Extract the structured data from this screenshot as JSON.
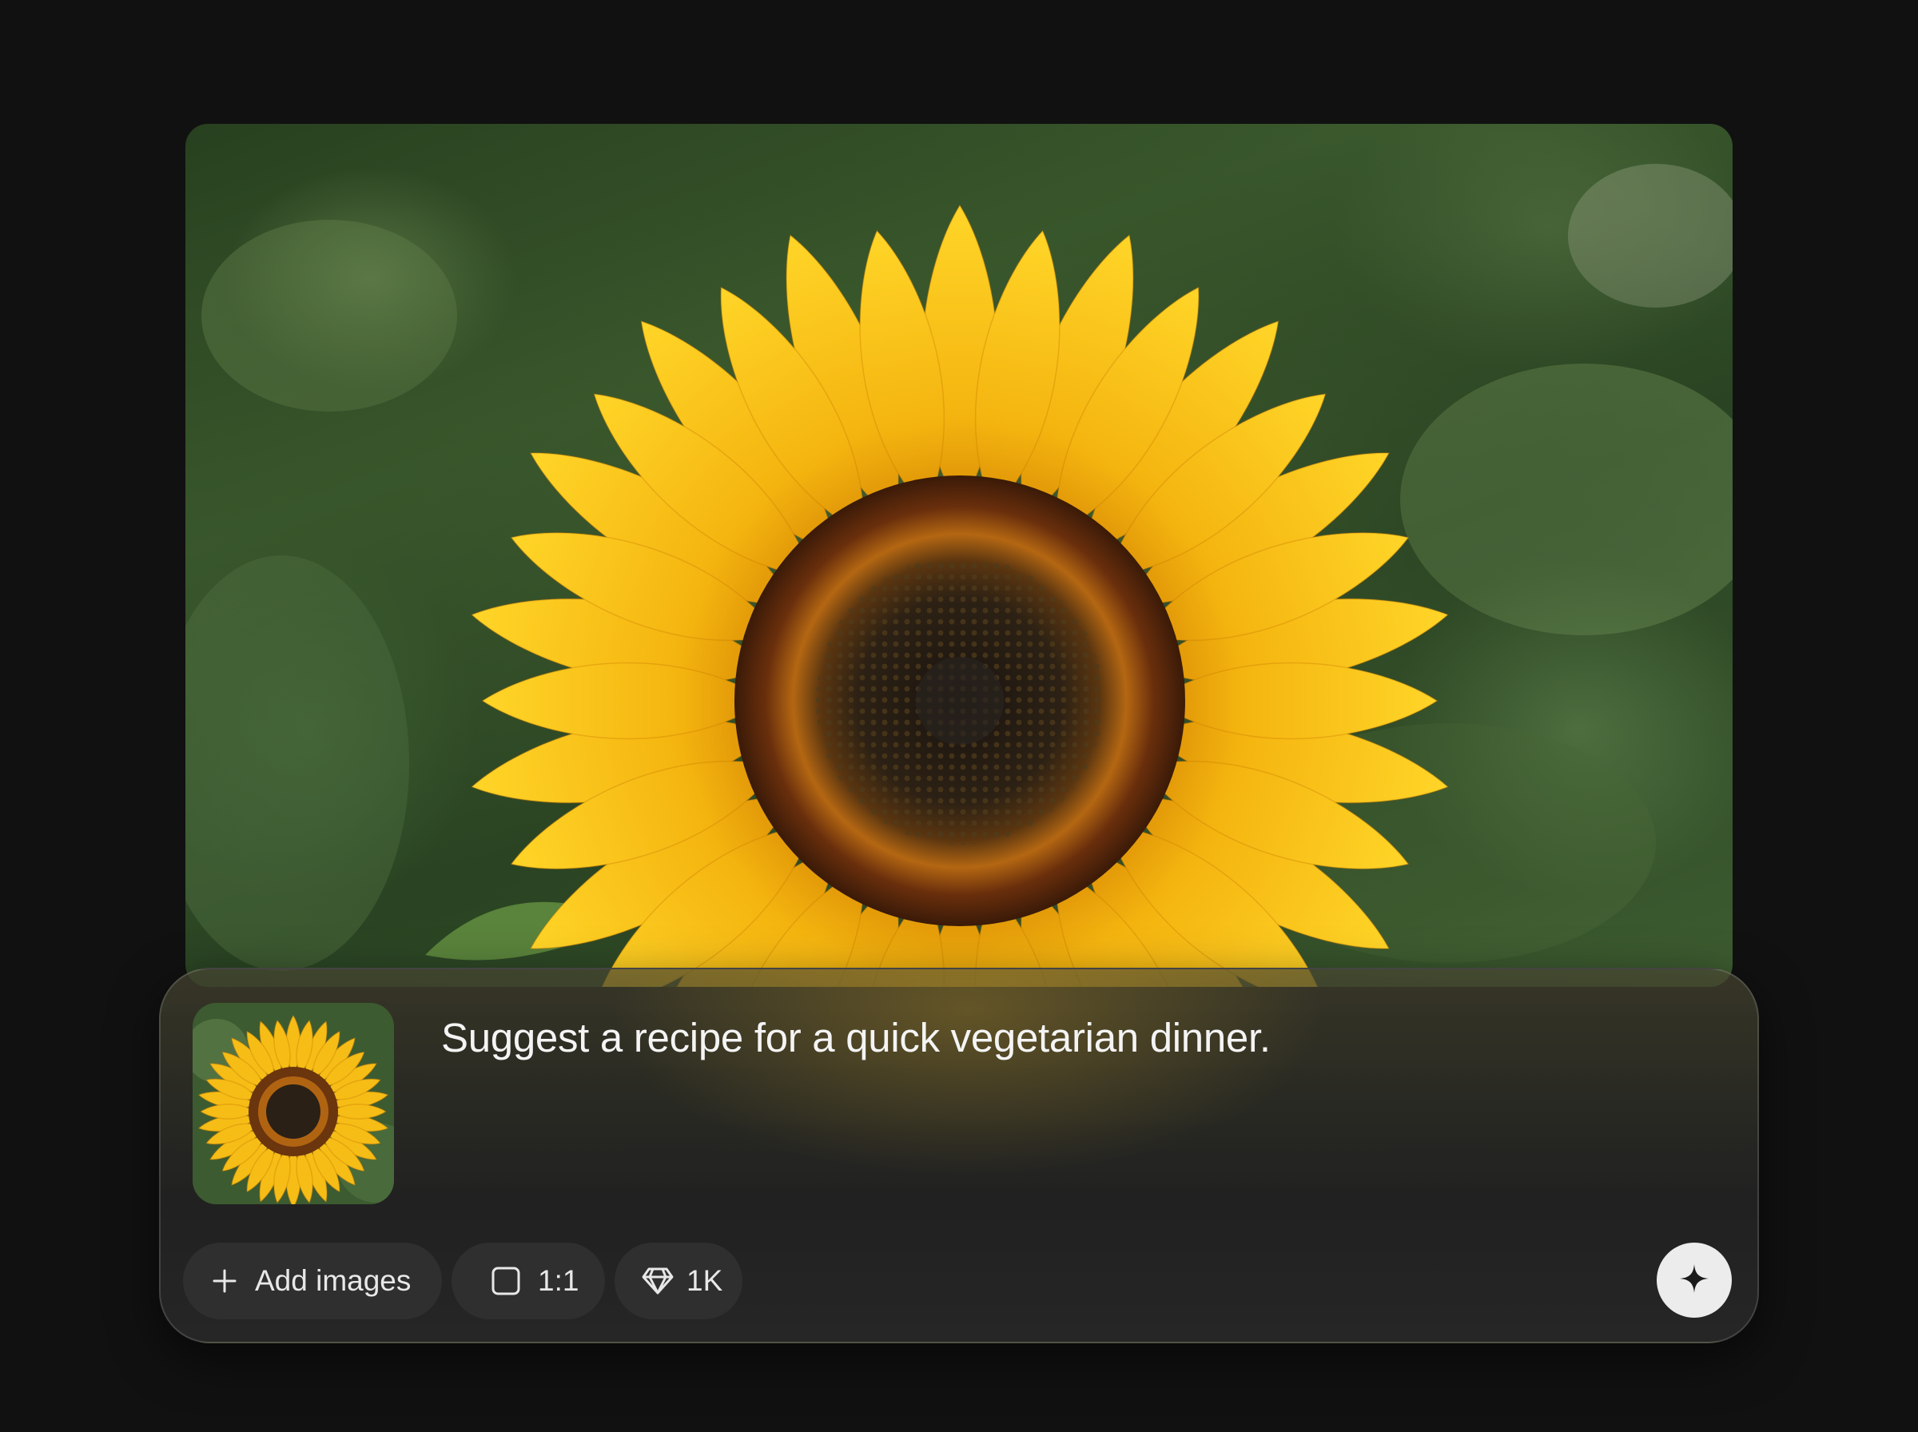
{
  "hero_image": {
    "alt": "sunflower-photo",
    "accent_petal": "#F5C518",
    "accent_disc": "#3A2210"
  },
  "composer": {
    "attachment": {
      "icon": "sunflower-thumbnail"
    },
    "prompt": "Suggest a recipe for a quick vegetarian dinner.",
    "toolbar": {
      "add_images_label": "Add images",
      "add_icon": "plus-icon",
      "aspect_ratio_label": "1:1",
      "aspect_icon": "square-icon",
      "quality_label": "1K",
      "quality_icon": "diamond-icon"
    },
    "send": {
      "icon": "sparkle-icon",
      "background": "#ECECEC"
    }
  }
}
